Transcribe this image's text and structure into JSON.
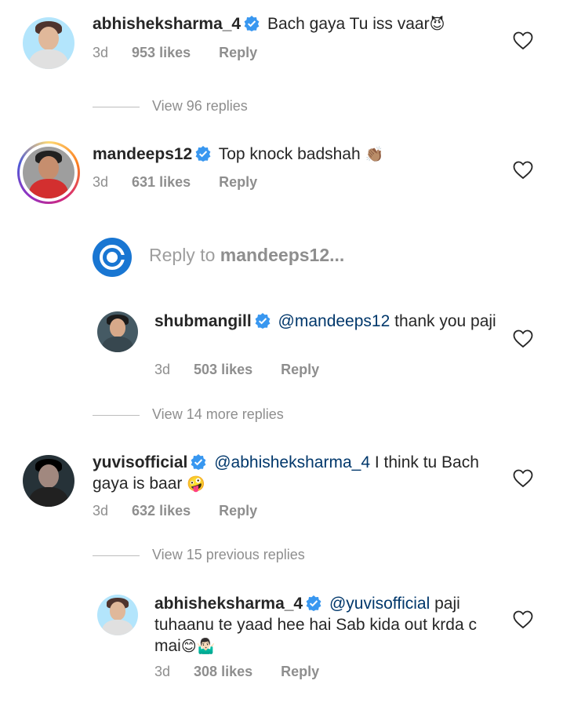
{
  "colors": {
    "text": "#262626",
    "muted": "#8e8e8e",
    "mention": "#00376b",
    "verified": "#3897f0",
    "reply_logo": "#1976d2"
  },
  "comments": [
    {
      "username": "abhisheksharma_4",
      "text": "Bach gaya Tu iss vaar",
      "emoji": "😈",
      "time": "3d",
      "likes": "953 likes",
      "reply": "Reply"
    },
    {
      "username": "mandeeps12",
      "text": "Top knock badshah",
      "emoji": "👏🏽",
      "time": "3d",
      "likes": "631 likes",
      "reply": "Reply"
    },
    {
      "username": "shubmangill",
      "mention": "@mandeeps12",
      "text": "thank you paji",
      "time": "3d",
      "likes": "503 likes",
      "reply": "Reply"
    },
    {
      "username": "yuvisofficial",
      "mention": "@abhisheksharma_4",
      "text_line1": "I think tu Bach",
      "text_line2": "gaya is baar",
      "emoji": "🤪",
      "time": "3d",
      "likes": "632 likes",
      "reply": "Reply"
    },
    {
      "username": "abhisheksharma_4",
      "mention": "@yuvisofficial",
      "text_line1": "paji",
      "text_line2": "tuhaanu te yaad hee hai Sab kida out krda c",
      "text_line3": "mai",
      "emoji": "😊🤷🏻‍♂️",
      "time": "3d",
      "likes": "308 likes",
      "reply": "Reply"
    }
  ],
  "view_replies": [
    "View 96 replies",
    "View 14 more replies",
    "View 15 previous replies"
  ],
  "reply_input": {
    "prefix": "Reply to ",
    "target": "mandeeps12..."
  },
  "icons": {
    "verified": "verified-badge-icon",
    "like": "heart-outline-icon"
  }
}
